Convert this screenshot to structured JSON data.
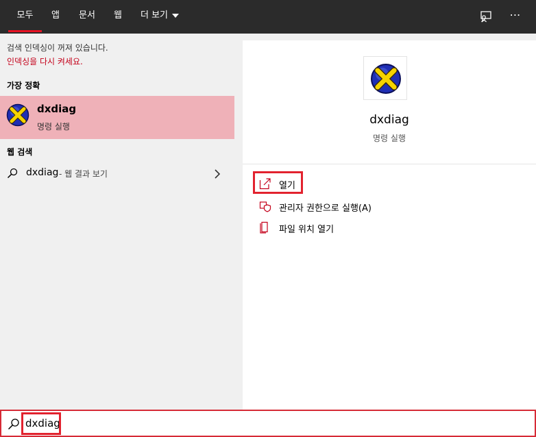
{
  "tabs": {
    "all": "모두",
    "apps": "앱",
    "documents": "문서",
    "web": "웹",
    "more": "더 보기"
  },
  "topbar_icons": {
    "feedback": "feedback-icon",
    "more": "⋯"
  },
  "left": {
    "index_notice": "검색 인덱싱이 꺼져 있습니다.",
    "index_link": "인덱싱을 다시 켜세요.",
    "best_match_title": "가장 정확",
    "best_match": {
      "name": "dxdiag",
      "type": "명령 실행",
      "icon": "dxdiag-icon"
    },
    "web_search_title": "웹 검색",
    "web_item": {
      "query": "dxdiag",
      "suffix": "- 웹 결과 보기"
    }
  },
  "right": {
    "app_name": "dxdiag",
    "app_type": "명령 실행",
    "actions": [
      {
        "label": "열기",
        "icon": "open-icon"
      },
      {
        "label": "관리자 권한으로 실행(A)",
        "icon": "shield-icon"
      },
      {
        "label": "파일 위치 열기",
        "icon": "file-location-icon"
      }
    ]
  },
  "search": {
    "value": "dxdiag"
  },
  "colors": {
    "topbar": "#2b2b2b",
    "accent": "#e81123",
    "selection": "#efb1b8",
    "link": "#c4001a",
    "highlight_box": "#e2222e"
  }
}
